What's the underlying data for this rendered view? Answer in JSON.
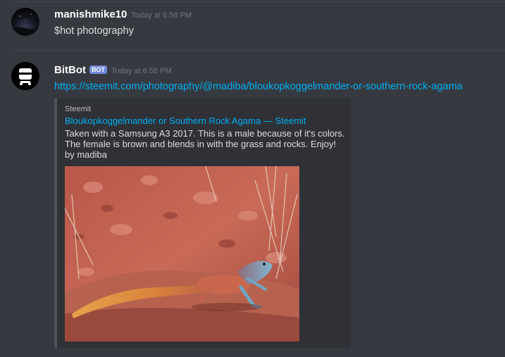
{
  "messages": [
    {
      "username": "manishmike10",
      "timestamp": "Today at 6:58 PM",
      "content": "$hot photography"
    },
    {
      "username": "BitBot",
      "bot_tag": "BOT",
      "timestamp": "Today at 6:58 PM",
      "link": "https://steemit.com/photography/@madiba/bloukopkoggelmander-or-southern-rock-agama",
      "embed": {
        "provider": "Steemit",
        "title": "Bloukopkoggelmander or Southern Rock Agama — Steemit",
        "description": "Taken with a Samsung A3 2017. This is a male because of it's colors. The female is brown and blends in with the grass and rocks. Enjoy! by madiba",
        "image_icon": "lizard-photo"
      }
    }
  ],
  "colors": {
    "background": "#36393f",
    "link": "#00b0f4",
    "bot_tag": "#7289da",
    "embed_bg": "#2f3136"
  }
}
